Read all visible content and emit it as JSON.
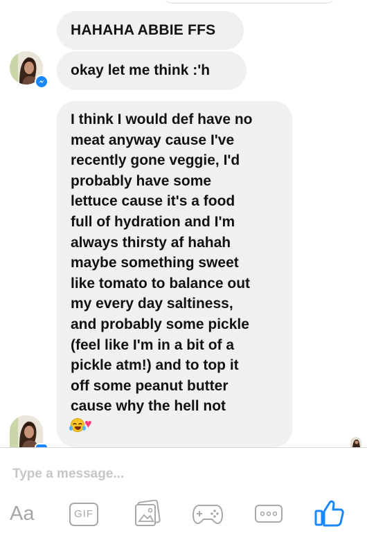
{
  "messages": [
    {
      "text": "HAHAHA ABBIE FFS"
    },
    {
      "text": "okay let me think :'h"
    },
    {
      "lines": [
        "I think I would def have no",
        "meat anyway cause I've",
        "recently gone veggie, I'd",
        "probably have some",
        "lettuce cause it's a food",
        "full of hydration and I'm",
        "always thirsty af hahah",
        "maybe something sweet",
        "like tomato to balance out",
        "my every day saltiness,",
        "and probably some pickle",
        "(feel like I'm in a bit of a",
        "pickle atm!) and to top it",
        "off some peanut butter",
        "cause why the hell not"
      ]
    }
  ],
  "composer": {
    "placeholder": "Type a message..."
  },
  "toolbar": {
    "text_style_label": "Aa",
    "gif_label": "GIF"
  },
  "colors": {
    "bubble": "#f1f0f0",
    "accent": "#1a86ff",
    "icon": "#a8a8a8"
  },
  "icons": [
    "messenger-badge-icon",
    "crying-laughing-emoji",
    "hearts-emoji",
    "image-icon",
    "game-controller-icon",
    "more-icon",
    "thumbs-up-icon"
  ]
}
